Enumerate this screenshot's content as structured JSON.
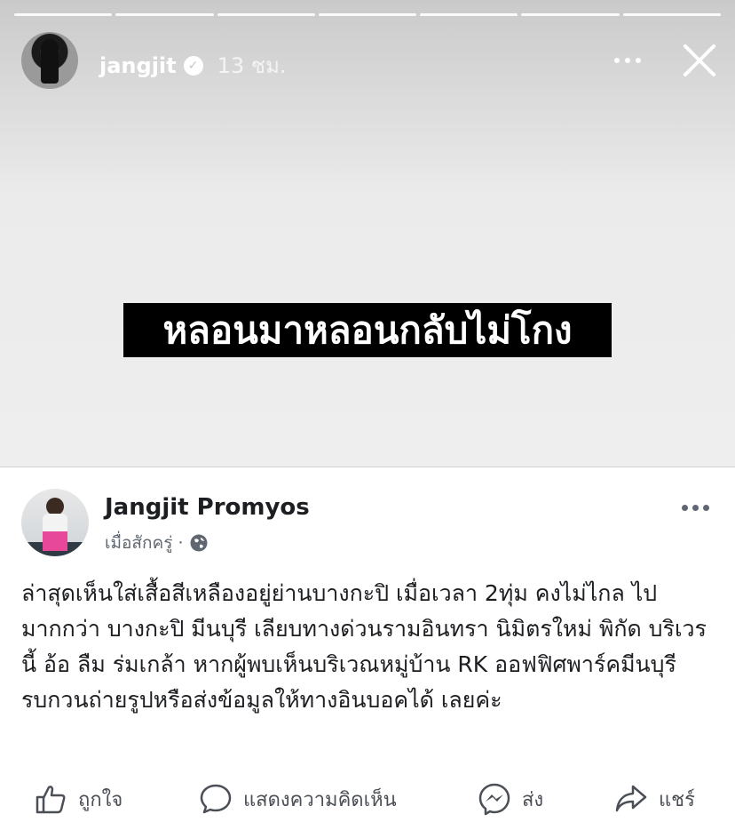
{
  "story": {
    "username": "jangjit",
    "time": "13 ชม.",
    "caption": "หลอนมาหลอนกลับไม่โกง",
    "icons": {
      "verified": "verified-badge-icon",
      "more": "more-options-icon",
      "close": "close-icon"
    }
  },
  "post": {
    "author": "Jangjit Promyos",
    "time": "เมื่อสักครู่",
    "separator": "·",
    "body": "ล่าสุดเห็นใส่เสื้อสีเหลืองอยู่ย่านบางกะปิ  เมื่อเวลา 2ทุ่ม คงไม่ไกล ไปมากกว่า บางกะปิ มีนบุรี เลียบทางด่วนรามอินทรา นิมิตรใหม่ พิกัด บริเวร นี้ อ้อ ลืม ร่มเกล้า หากผู้พบเห็นบริเวณหมู่บ้าน RK ออฟฟิศพาร์คมีนบุรี รบกวนถ่ายรูปหรือส่งข้อมูลให้ทางอินบอคได้ เลยค่ะ",
    "actions": {
      "like": "ถูกใจ",
      "comment": "แสดงความคิดเห็น",
      "send": "ส่ง",
      "share": "แชร์"
    }
  },
  "colors": {
    "caption_bg": "#000000",
    "text_primary": "#1c1e21",
    "text_secondary": "#606770"
  }
}
